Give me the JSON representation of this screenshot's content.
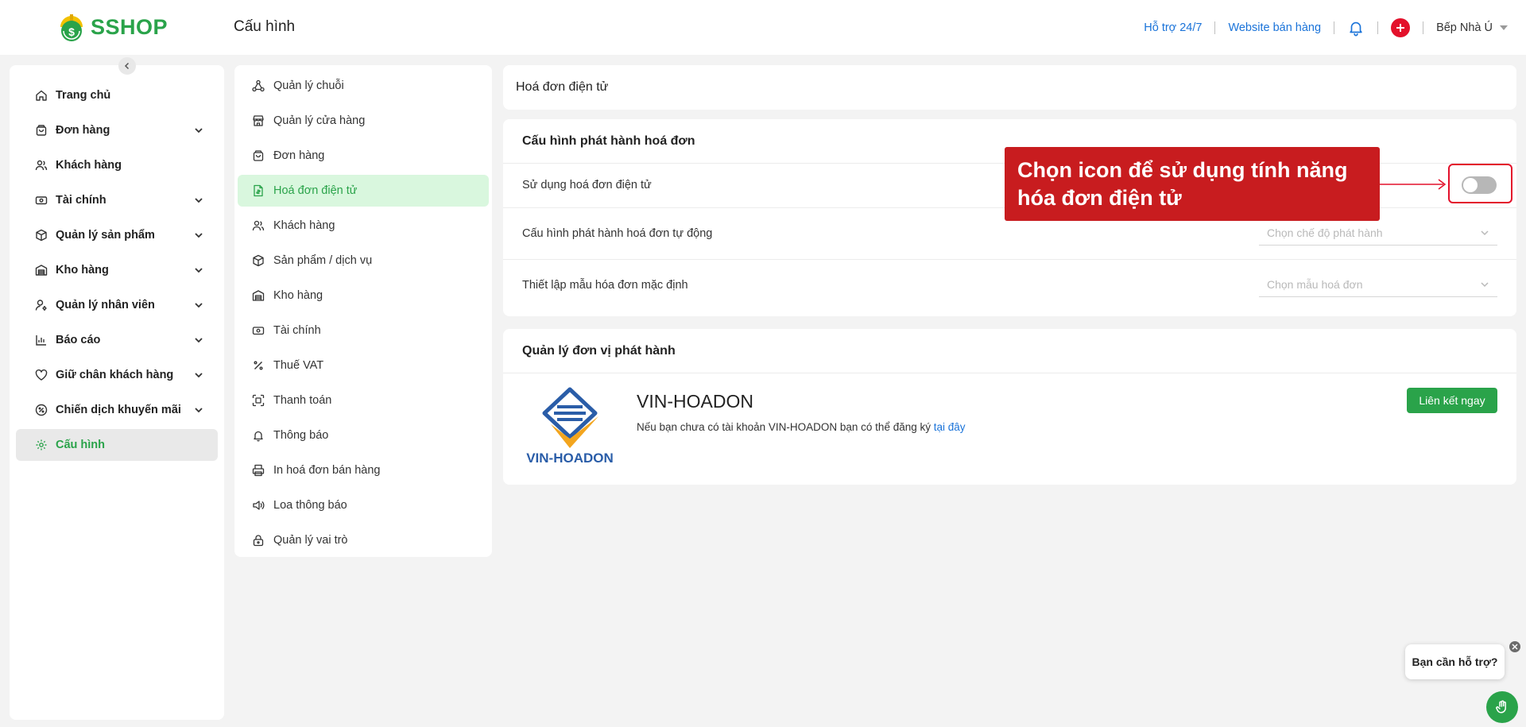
{
  "brand": {
    "name": "SSHOP",
    "color": "#2aa34a"
  },
  "header": {
    "title": "Cấu hình",
    "support_link": "Hỗ trợ 24/7",
    "website_link": "Website bán hàng",
    "user_name": "Bếp Nhà Ú"
  },
  "sidebar": {
    "items": [
      {
        "label": "Trang chủ",
        "icon": "home-icon"
      },
      {
        "label": "Đơn hàng",
        "icon": "shopping-bag-icon"
      },
      {
        "label": "Khách hàng",
        "icon": "users-icon"
      },
      {
        "label": "Tài chính",
        "icon": "banknote-icon"
      },
      {
        "label": "Quản lý sản phẩm",
        "icon": "box-icon"
      },
      {
        "label": "Kho hàng",
        "icon": "warehouse-icon"
      },
      {
        "label": "Quản lý nhân viên",
        "icon": "user-settings-icon"
      },
      {
        "label": "Báo cáo",
        "icon": "bar-chart-icon"
      },
      {
        "label": "Giữ chân khách hàng",
        "icon": "heart-icon"
      },
      {
        "label": "Chiến dịch khuyến mãi",
        "icon": "discount-icon"
      },
      {
        "label": "Cấu hình",
        "icon": "gear-icon"
      }
    ]
  },
  "submenu": {
    "items": [
      {
        "label": "Quản lý chuỗi",
        "icon": "network-icon"
      },
      {
        "label": "Quản lý cửa hàng",
        "icon": "store-icon"
      },
      {
        "label": "Đơn hàng",
        "icon": "shopping-bag-icon"
      },
      {
        "label": "Hoá đơn điện tử",
        "icon": "invoice-icon"
      },
      {
        "label": "Khách hàng",
        "icon": "users-icon"
      },
      {
        "label": "Sản phẩm / dịch vụ",
        "icon": "box-icon"
      },
      {
        "label": "Kho hàng",
        "icon": "warehouse-icon"
      },
      {
        "label": "Tài chính",
        "icon": "banknote-icon"
      },
      {
        "label": "Thuế VAT",
        "icon": "percent-icon"
      },
      {
        "label": "Thanh toán",
        "icon": "scan-icon"
      },
      {
        "label": "Thông báo",
        "icon": "bell-icon"
      },
      {
        "label": "In hoá đơn bán hàng",
        "icon": "printer-icon"
      },
      {
        "label": "Loa thông báo",
        "icon": "speaker-icon"
      },
      {
        "label": "Quản lý vai trò",
        "icon": "lock-icon"
      }
    ]
  },
  "main": {
    "section_title": "Hoá đơn điện tử",
    "config": {
      "title": "Cấu hình phát hành hoá đơn",
      "use_einvoice_label": "Sử dụng hoá đơn điện tử",
      "use_einvoice_enabled": false,
      "auto_issue_label": "Cấu hình phát hành hoá đơn tự động",
      "auto_issue_placeholder": "Chọn chế độ phát hành",
      "default_template_label": "Thiết lập mẫu hóa đơn mặc định",
      "default_template_placeholder": "Chọn mẫu hoá đơn"
    },
    "issuer": {
      "title": "Quản lý đơn vị phát hành",
      "logo_text": "VIN-HOADON",
      "name": "VIN-HOADON",
      "desc": "Nếu bạn chưa có tài khoản VIN-HOADON bạn có thể đăng ký ",
      "desc_link": "tại đây",
      "link_button": "Liên kết ngay"
    }
  },
  "annotation": {
    "callout_text": "Chọn icon để sử dụng tính năng hóa đơn điện tử",
    "color": "#c81c1f"
  },
  "support": {
    "bubble_text": "Bạn cần hỗ trợ?"
  }
}
